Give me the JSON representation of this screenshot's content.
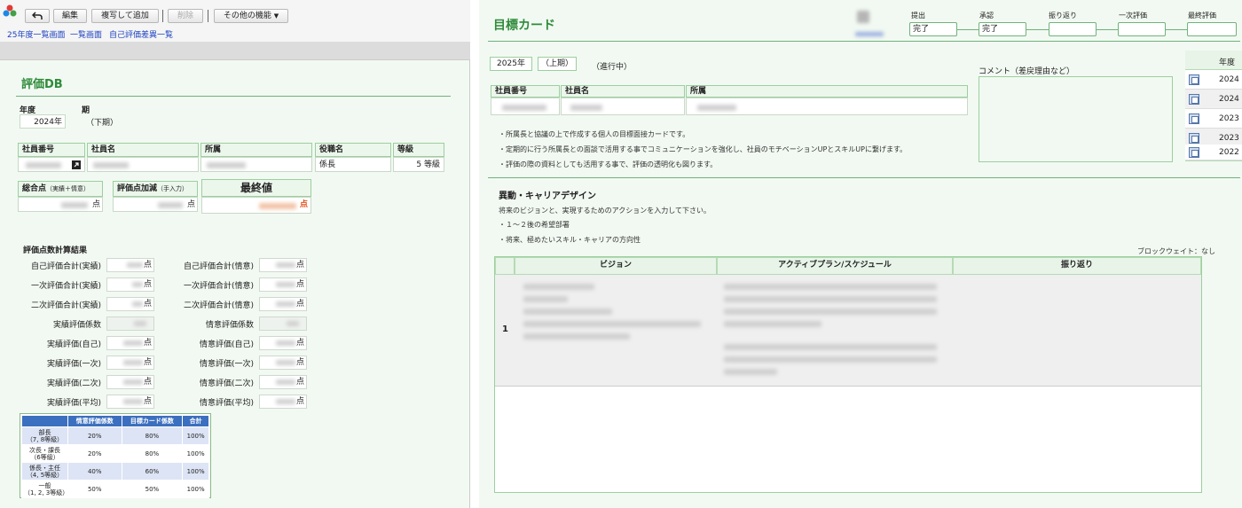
{
  "left": {
    "toolbar": {
      "back_icon": "undo-arrow-icon",
      "edit_label": "編集",
      "copy_add_label": "複写して追加",
      "delete_label": "削除",
      "more_label": "その他の機能",
      "links": [
        "25年度一覧画面",
        "一覧画面",
        "自己評価差異一覧"
      ]
    },
    "title": "評価DB",
    "year_label": "年度",
    "year_value": "2024年",
    "term_label": "期",
    "term_value": "（下期）",
    "employee_headers": [
      "社員番号",
      "社員名",
      "所属",
      "役職名",
      "等級"
    ],
    "position_value": "係長",
    "grade_value": "5 等級",
    "total_label": "総合点",
    "total_sub": "（実績＋情意）",
    "adjust_label": "評価点加減",
    "adjust_sub": "（手入力）",
    "final_label": "最終値",
    "point_unit": "点",
    "calc_title": "評価点数計算結果",
    "calc_left": [
      "自己評価合計(実績)",
      "一次評価合計(実績)",
      "二次評価合計(実績)",
      "実績評価係数",
      "実績評価(自己)",
      "実績評価(一次)",
      "実績評価(二次)",
      "実績評価(平均)"
    ],
    "calc_right": [
      "自己評価合計(情意)",
      "一次評価合計(情意)",
      "二次評価合計(情意)",
      "情意評価係数",
      "情意評価(自己)",
      "情意評価(一次)",
      "情意評価(二次)",
      "情意評価(平均)"
    ],
    "coef_table": {
      "headers": [
        "",
        "情意評価係数",
        "目標カード係数",
        "合計"
      ],
      "rows": [
        [
          "部長\n（7, 8等級）",
          "20%",
          "80%",
          "100%"
        ],
        [
          "次長・課長\n（6等級）",
          "20%",
          "80%",
          "100%"
        ],
        [
          "係長・主任\n（4, 5等級）",
          "40%",
          "60%",
          "100%"
        ],
        [
          "一般\n（1, 2, 3等級）",
          "50%",
          "50%",
          "100%"
        ]
      ]
    }
  },
  "right": {
    "title": "目標カード",
    "steps": [
      {
        "label": "提出",
        "value": "完了"
      },
      {
        "label": "承認",
        "value": "完了"
      },
      {
        "label": "振り返り",
        "value": ""
      },
      {
        "label": "一次評価",
        "value": ""
      },
      {
        "label": "最終評価",
        "value": ""
      }
    ],
    "year_value": "2025年",
    "term_value": "（上期）",
    "status": "（進行中）",
    "employee_headers": [
      "社員番号",
      "社員名",
      "所属"
    ],
    "notes": [
      "・所属長と協議の上で作成する個人の目標面接カードです。",
      "・定期的に行う所属長との面談で活用する事でコミュニケーションを強化し、社員のモチベーションUPとスキルUPに繋げます。",
      "・評価の際の資料としても活用する事で、評価の透明化も図ります。"
    ],
    "comment_label": "コメント（差戻理由など）",
    "history_header": "年度",
    "history_years": [
      "2024",
      "2024",
      "2023",
      "2023",
      "2022"
    ],
    "career_title": "異動・キャリアデザイン",
    "career_desc": "将来のビジョンと、実現するためのアクションを入力して下さい。",
    "career_points": [
      "・１～２後の希望部署",
      "・将来、極めたいスキル・キャリアの方向性"
    ],
    "block_weight": "ブロックウェイト：なし",
    "grid_headers": [
      "ビジョン",
      "アクティブプラン/スケジュール",
      "振り返り"
    ],
    "row_number": "1"
  }
}
